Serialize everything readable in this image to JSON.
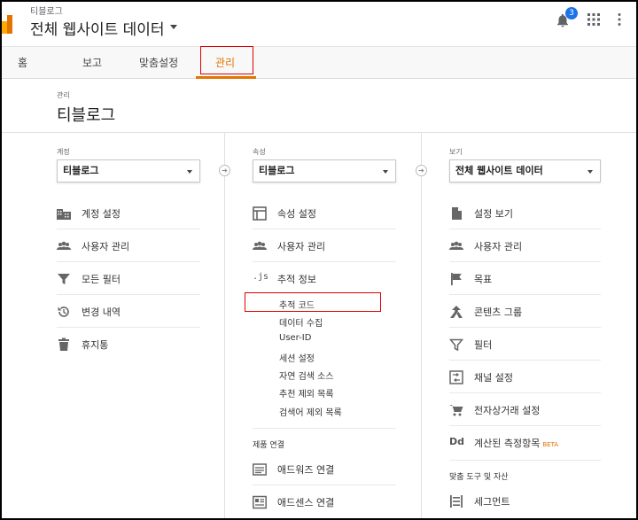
{
  "topbar": {
    "account_name": "티블로그",
    "property_title": "전체 웹사이트 데이터",
    "notification_count": "3"
  },
  "nav": {
    "items": [
      {
        "label": "홈"
      },
      {
        "label": "보고"
      },
      {
        "label": "맞춤설정"
      },
      {
        "label": "관리"
      }
    ],
    "active": "관리"
  },
  "admin": {
    "small_label": "관리",
    "title": "티블로그"
  },
  "account_col": {
    "label": "계정",
    "selected": "티블로그",
    "items": [
      {
        "label": "계정 설정",
        "icon": "building-icon"
      },
      {
        "label": "사용자 관리",
        "icon": "users-icon"
      },
      {
        "label": "모든 필터",
        "icon": "filter-icon"
      },
      {
        "label": "변경 내역",
        "icon": "history-icon"
      },
      {
        "label": "휴지통",
        "icon": "trash-icon"
      }
    ]
  },
  "property_col": {
    "label": "속성",
    "selected": "티블로그",
    "items": [
      {
        "label": "속성 설정",
        "icon": "property-settings-icon"
      },
      {
        "label": "사용자 관리",
        "icon": "users-icon"
      },
      {
        "label": "추적 정보",
        "icon": "js-icon",
        "icon_text": ".js"
      }
    ],
    "tracking_sub": [
      "추적 코드",
      "데이터 수집",
      "User-ID",
      "세션 설정",
      "자연 검색 소스",
      "추천 제외 목록",
      "검색어 제외 목록"
    ],
    "product_link_label": "제품 연결",
    "product_links": [
      {
        "label": "애드워즈 연결",
        "icon": "adwords-icon"
      },
      {
        "label": "애드센스 연결",
        "icon": "adsense-icon"
      }
    ]
  },
  "view_col": {
    "label": "보기",
    "selected": "전체 웹사이트 데이터",
    "items": [
      {
        "label": "설정 보기",
        "icon": "document-icon"
      },
      {
        "label": "사용자 관리",
        "icon": "users-icon"
      },
      {
        "label": "목표",
        "icon": "flag-icon"
      },
      {
        "label": "콘텐츠 그룹",
        "icon": "content-group-icon"
      },
      {
        "label": "필터",
        "icon": "filter-icon"
      },
      {
        "label": "채널 설정",
        "icon": "channel-icon"
      },
      {
        "label": "전자상거래 설정",
        "icon": "cart-icon"
      },
      {
        "label": "계산된 측정항목",
        "icon": "dd-icon",
        "icon_text": "Dd",
        "badge": "BETA"
      }
    ],
    "tools_label": "맞춤 도구 및 자산",
    "tools": [
      {
        "label": "세그먼트",
        "icon": "segment-icon"
      }
    ]
  },
  "colors": {
    "accent": "#e37400",
    "highlight_box": "#e00000",
    "badge_blue": "#1a73e8"
  }
}
